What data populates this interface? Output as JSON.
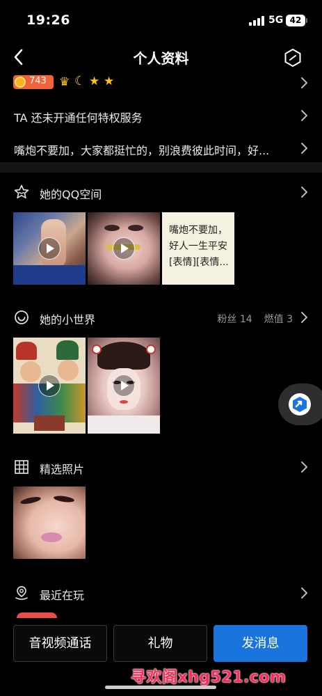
{
  "status_bar": {
    "time": "19:26",
    "network": "5G",
    "battery": "42"
  },
  "nav": {
    "title": "个人资料"
  },
  "profile": {
    "level": "743",
    "privilege_text": "TA 还未开通任何特权服务",
    "signature": "嘴炮不要加，大家都挺忙的，别浪费彼此时间，好..."
  },
  "qzone": {
    "title": "她的QQ空间",
    "text_post": [
      "嘴炮不要加，",
      "好人一生平安",
      "[表情][表情..."
    ]
  },
  "small_world": {
    "title": "她的小世界",
    "fans_label": "粉丝",
    "fans_count": "14",
    "heat_label": "燃值",
    "heat_count": "3"
  },
  "photos": {
    "title": "精选照片"
  },
  "recent": {
    "title": "最近在玩"
  },
  "actions": {
    "call_label": "音视频通话",
    "gift_label": "礼物",
    "message_label": "发消息"
  },
  "watermark": "寻欢阁xhg521.com",
  "colors": {
    "accent": "#1a74dd",
    "level_badge": "#f0623a",
    "gold": "#ffc21a"
  },
  "icons": [
    "back-icon",
    "more-icon",
    "star-outline-icon",
    "circle-icon",
    "grid-icon",
    "location-icon",
    "chevron-right-icon",
    "play-icon",
    "crown-icon",
    "moon-icon",
    "star-icon"
  ]
}
